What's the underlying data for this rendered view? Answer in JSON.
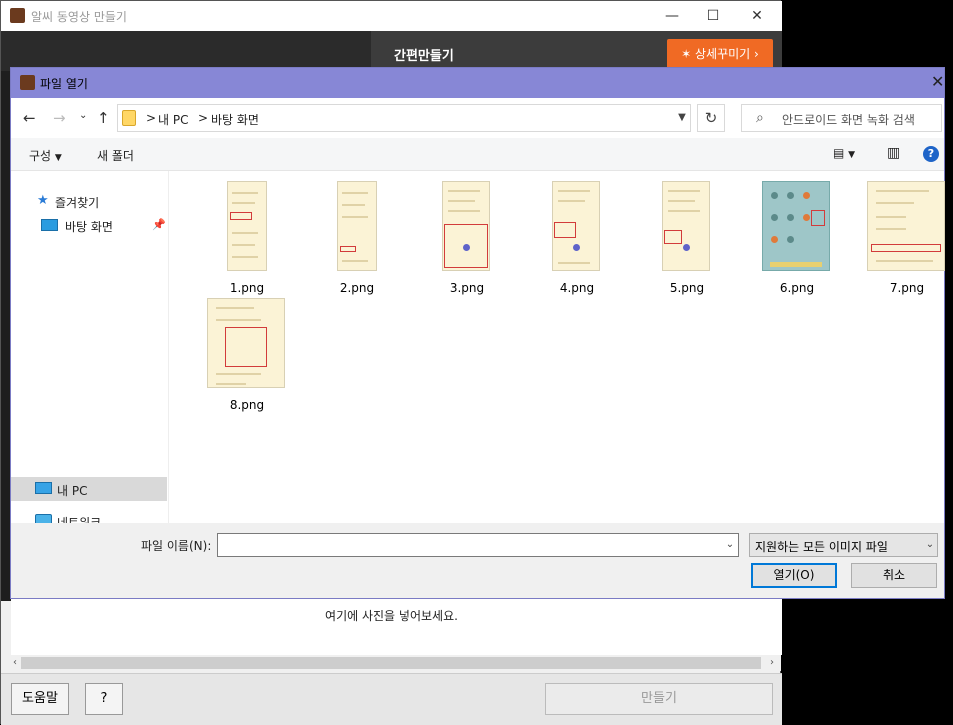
{
  "background_app": {
    "title": "알씨 동영상 만들기",
    "tab_simple": "간편만들기",
    "detail_button": "상세꾸미기",
    "drop_hint": "여기에 사진을 넣어보세요.",
    "help_button": "도움말",
    "question_button": "?",
    "make_button": "만들기"
  },
  "dialog": {
    "title": "파일 열기",
    "address": {
      "separator": ">",
      "crumbs": [
        "내 PC",
        "바탕 화면"
      ]
    },
    "search_placeholder": "안드로이드 화면 녹화 검색",
    "toolbar": {
      "organize": "구성",
      "new_folder": "새 폴더",
      "help": "?"
    },
    "nav": {
      "favorites": "즐겨찾기",
      "desktop": "바탕 화면",
      "this_pc": "내 PC",
      "network": "네트워크"
    },
    "files": [
      {
        "name": "1.png"
      },
      {
        "name": "2.png"
      },
      {
        "name": "3.png"
      },
      {
        "name": "4.png"
      },
      {
        "name": "5.png"
      },
      {
        "name": "6.png"
      },
      {
        "name": "7.png"
      },
      {
        "name": "8.png"
      }
    ],
    "filename_label": "파일 이름(N):",
    "filename_value": "",
    "filter_value": "지원하는 모든 이미지 파일",
    "open_button": "열기(O)",
    "cancel_button": "취소"
  },
  "colors": {
    "dialog_titlebar": "#8787d6",
    "accent_button": "#f06a24",
    "selection": "#d9d9d9"
  }
}
